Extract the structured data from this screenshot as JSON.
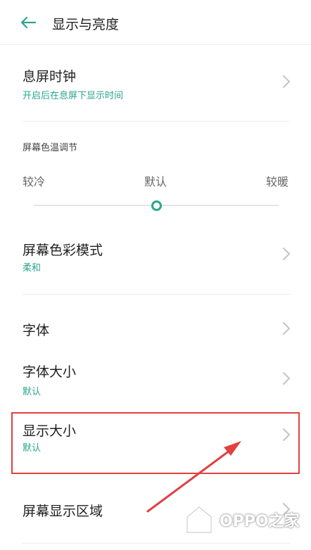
{
  "colors": {
    "accent": "#2aa58d",
    "annotation": "#e04141"
  },
  "header": {
    "title": "显示与亮度",
    "back_icon": "arrow-left-icon"
  },
  "aod": {
    "title": "息屏时钟",
    "subtitle": "开启后在息屏下显示时间"
  },
  "color_temp": {
    "label": "屏幕色温调节",
    "cold": "较冷",
    "default": "默认",
    "warm": "较暖",
    "slider_value": 0.5
  },
  "color_mode": {
    "title": "屏幕色彩模式",
    "value": "柔和"
  },
  "font": {
    "title": "字体"
  },
  "font_size": {
    "title": "字体大小",
    "value": "默认"
  },
  "display_size": {
    "title": "显示大小",
    "value": "默认"
  },
  "display_area": {
    "title": "屏幕显示区域"
  },
  "watermark": {
    "text": "OPPO之家"
  }
}
